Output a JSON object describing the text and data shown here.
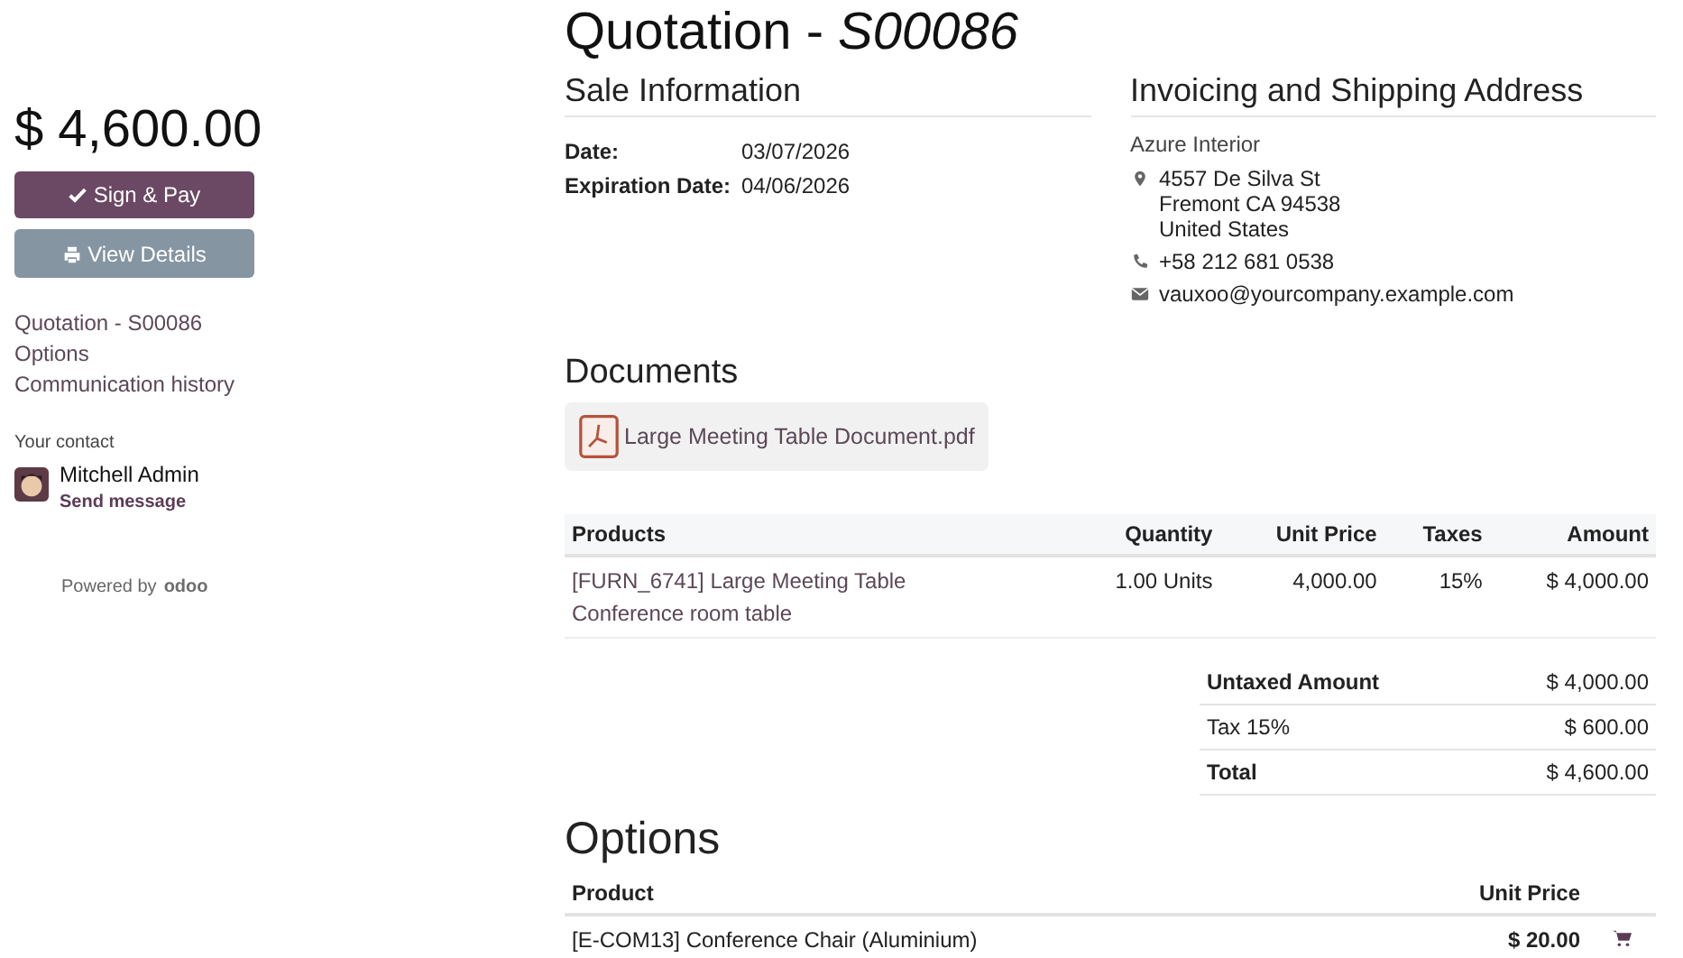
{
  "sidebar": {
    "total": "$ 4,600.00",
    "buttons": [
      {
        "kind": "primary",
        "label": "Sign & Pay"
      },
      {
        "kind": "secondary",
        "label": "View Details"
      }
    ],
    "nav": [
      "Quotation - S00086",
      "Options",
      "Communication history"
    ],
    "contact": {
      "heading": "Your contact",
      "name": "Mitchell Admin",
      "action": "Send message"
    },
    "powered_by": {
      "text": "Powered by",
      "brand": "odoo"
    }
  },
  "title": {
    "prefix": "Quotation - ",
    "number": "S00086"
  },
  "sale_info": {
    "heading": "Sale Information",
    "fields": [
      {
        "label": "Date:",
        "value": "03/07/2026"
      },
      {
        "label": "Expiration Date:",
        "value": "04/06/2026"
      }
    ]
  },
  "address": {
    "heading": "Invoicing and Shipping Address",
    "company": "Azure Interior",
    "lines": [
      {
        "kind": "address",
        "text": [
          "4557 De Silva St",
          "Fremont CA 94538",
          "United States"
        ]
      },
      {
        "kind": "phone",
        "text": [
          "+58 212 681 0538"
        ]
      },
      {
        "kind": "email",
        "text": [
          "vauxoo@yourcompany.example.com"
        ]
      }
    ]
  },
  "documents": {
    "heading": "Documents",
    "files": [
      "Large Meeting Table Document.pdf"
    ]
  },
  "products": {
    "columns": [
      "Products",
      "Quantity",
      "Unit Price",
      "Taxes",
      "Amount"
    ],
    "rows": [
      {
        "name": "[FURN_6741] Large Meeting Table",
        "description": "Conference room table",
        "quantity": "1.00 Units",
        "unit_price": "4,000.00",
        "taxes": "15%",
        "amount": "$ 4,000.00"
      }
    ]
  },
  "totals": [
    {
      "label": "Untaxed Amount",
      "value": "$ 4,000.00",
      "bold": true
    },
    {
      "label": "Tax 15%",
      "value": "$ 600.00",
      "bold": false
    },
    {
      "label": "Total",
      "value": "$ 4,600.00",
      "bold": true
    }
  ],
  "options": {
    "heading": "Options",
    "columns": [
      "Product",
      "Unit Price"
    ],
    "rows": [
      {
        "name": "[E-COM13] Conference Chair (Aluminium)",
        "price": "$ 20.00"
      }
    ]
  }
}
